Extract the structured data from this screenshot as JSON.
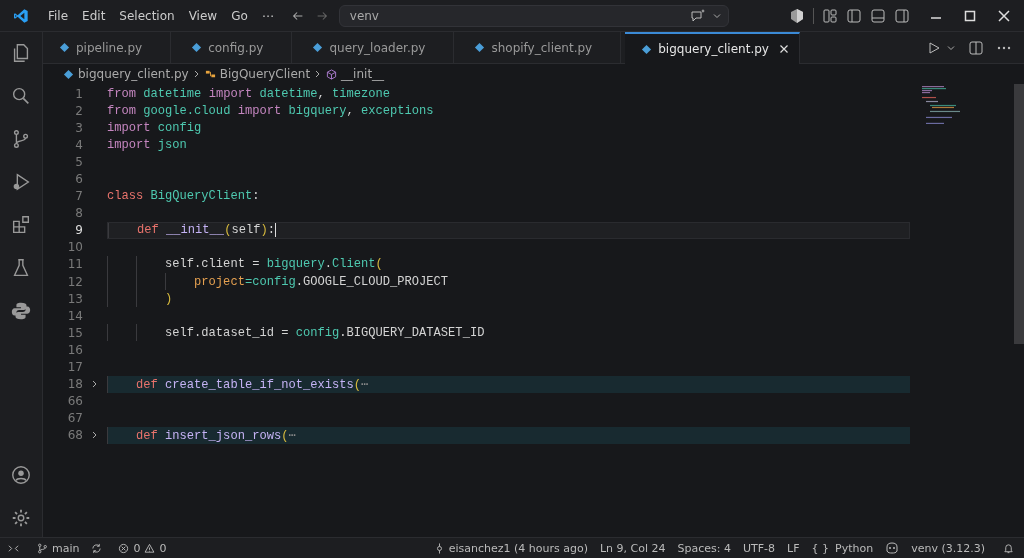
{
  "menu": [
    "File",
    "Edit",
    "Selection",
    "View",
    "Go",
    "⋯"
  ],
  "command_center": {
    "value": "venv"
  },
  "tabs": [
    {
      "label": "pipeline.py",
      "selected": false
    },
    {
      "label": "config.py",
      "selected": false
    },
    {
      "label": "query_loader.py",
      "selected": false
    },
    {
      "label": "shopify_client.py",
      "selected": false
    },
    {
      "label": "bigquery_client.py",
      "selected": true
    }
  ],
  "breadcrumb": [
    "bigquery_client.py",
    "BigQueryClient",
    "__init__"
  ],
  "lines": [
    {
      "number": "1",
      "tokens": [
        {
          "text": "from ",
          "kind": "kw"
        },
        {
          "text": "datetime ",
          "kind": "mod"
        },
        {
          "text": "import ",
          "kind": "kw"
        },
        {
          "text": "datetime",
          "kind": "mod"
        },
        {
          "text": ", ",
          "kind": "plain"
        },
        {
          "text": "timezone",
          "kind": "mod"
        }
      ]
    },
    {
      "number": "2",
      "tokens": [
        {
          "text": "from ",
          "kind": "kw"
        },
        {
          "text": "google.cloud ",
          "kind": "mod"
        },
        {
          "text": "import ",
          "kind": "kw"
        },
        {
          "text": "bigquery",
          "kind": "mod"
        },
        {
          "text": ", ",
          "kind": "plain"
        },
        {
          "text": "exceptions",
          "kind": "mod"
        }
      ]
    },
    {
      "number": "3",
      "tokens": [
        {
          "text": "import ",
          "kind": "kw"
        },
        {
          "text": "config",
          "kind": "mod"
        }
      ]
    },
    {
      "number": "4",
      "tokens": [
        {
          "text": "import ",
          "kind": "kw"
        },
        {
          "text": "json",
          "kind": "mod"
        }
      ]
    },
    {
      "number": "5"
    },
    {
      "number": "6"
    },
    {
      "number": "7",
      "tokens": [
        {
          "text": "class ",
          "kind": "decl"
        },
        {
          "text": "BigQueryClient",
          "kind": "mod"
        },
        {
          "text": ":",
          "kind": "plain"
        }
      ]
    },
    {
      "number": "8"
    },
    {
      "number": "9",
      "current": true,
      "tokens": [
        {
          "text": "    def ",
          "kind": "decl"
        },
        {
          "text": "__init__",
          "kind": "fn"
        },
        {
          "text": "(",
          "kind": "paren"
        },
        {
          "text": "self",
          "kind": "plain"
        },
        {
          "text": ")",
          "kind": "paren"
        },
        {
          "text": ":",
          "kind": "plain"
        }
      ]
    },
    {
      "number": "10"
    },
    {
      "number": "11",
      "tokens": [
        {
          "text": "        self.client = ",
          "kind": "plain"
        },
        {
          "text": "bigquery",
          "kind": "mod"
        },
        {
          "text": ".",
          "kind": "plain"
        },
        {
          "text": "Client",
          "kind": "mod"
        },
        {
          "text": "(",
          "kind": "paren"
        }
      ]
    },
    {
      "number": "12",
      "tokens": [
        {
          "text": "            project",
          "kind": "param"
        },
        {
          "text": "=config",
          "kind": "mod"
        },
        {
          "text": ".GOOGLE_CLOUD_PROJECT",
          "kind": "plain"
        }
      ]
    },
    {
      "number": "13",
      "tokens": [
        {
          "text": "        )",
          "kind": "paren"
        }
      ]
    },
    {
      "number": "14"
    },
    {
      "number": "15",
      "tokens": [
        {
          "text": "        self.dataset_id = ",
          "kind": "plain"
        },
        {
          "text": "config",
          "kind": "mod"
        },
        {
          "text": ".BIGQUERY_DATASET_ID",
          "kind": "plain"
        }
      ]
    },
    {
      "number": "16"
    },
    {
      "number": "17"
    },
    {
      "number": "18",
      "folded": true,
      "tokens": [
        {
          "text": "    def ",
          "kind": "decl"
        },
        {
          "text": "create_table_if_not_exists",
          "kind": "fn"
        },
        {
          "text": "(",
          "kind": "paren"
        },
        {
          "text": "⋯",
          "kind": "fold"
        }
      ]
    },
    {
      "number": "66"
    },
    {
      "number": "67"
    },
    {
      "number": "68",
      "folded": true,
      "tokens": [
        {
          "text": "    def ",
          "kind": "decl"
        },
        {
          "text": "insert_json_rows",
          "kind": "fn"
        },
        {
          "text": "(",
          "kind": "paren"
        },
        {
          "text": "⋯",
          "kind": "fold"
        }
      ]
    }
  ],
  "status_bar": {
    "branch": "main",
    "errors": "0",
    "warnings": "0",
    "blame": "eisanchez1 (4 hours ago)",
    "position": "Ln 9, Col 24",
    "spaces": "Spaces: 4",
    "encoding": "UTF-8",
    "eol": "LF",
    "language_icon": "{ }",
    "language": "Python",
    "interpreter": "venv (3.12.3)"
  }
}
